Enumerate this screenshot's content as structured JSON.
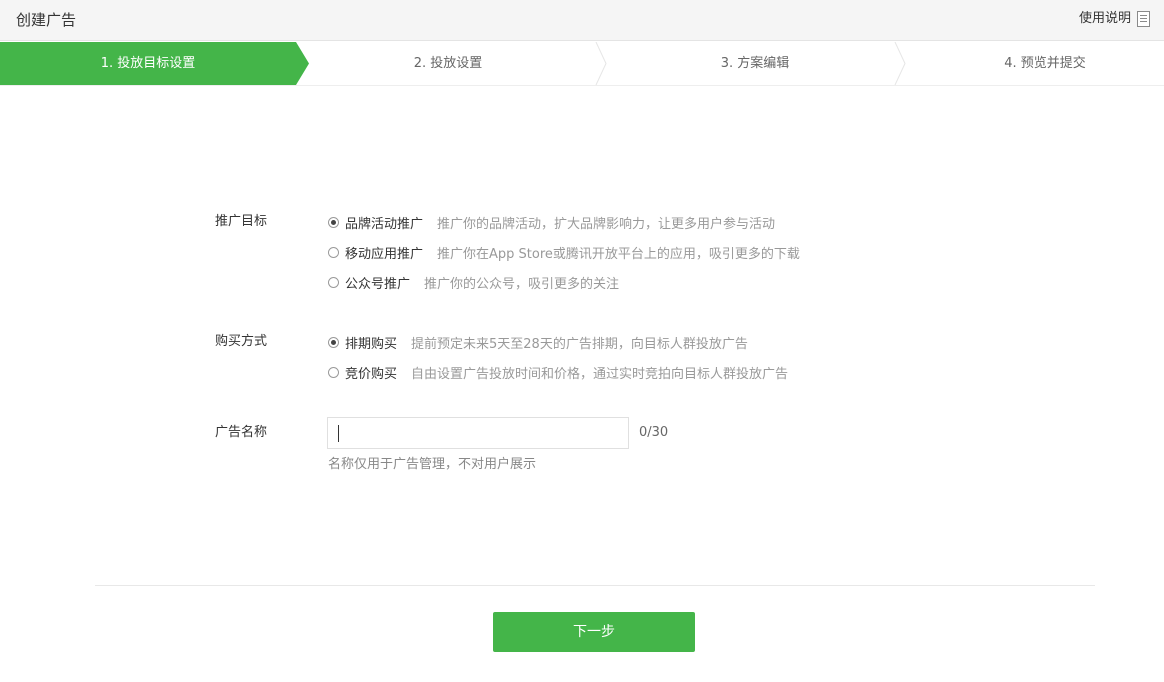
{
  "header": {
    "title": "创建广告",
    "help_label": "使用说明",
    "help_icon": "document-icon"
  },
  "steps": [
    {
      "label": "1. 投放目标设置",
      "active": true
    },
    {
      "label": "2. 投放设置",
      "active": false
    },
    {
      "label": "3. 方案编辑",
      "active": false
    },
    {
      "label": "4. 预览并提交",
      "active": false
    }
  ],
  "colors": {
    "accent": "#44b549",
    "muted_text": "#999999"
  },
  "form": {
    "goal": {
      "label": "推广目标",
      "options": [
        {
          "label": "品牌活动推广",
          "desc": "推广你的品牌活动，扩大品牌影响力，让更多用户参与活动",
          "checked": true
        },
        {
          "label": "移动应用推广",
          "desc": "推广你在App Store或腾讯开放平台上的应用，吸引更多的下载",
          "checked": false
        },
        {
          "label": "公众号推广",
          "desc": "推广你的公众号，吸引更多的关注",
          "checked": false
        }
      ]
    },
    "purchase": {
      "label": "购买方式",
      "options": [
        {
          "label": "排期购买",
          "desc": "提前预定未来5天至28天的广告排期，向目标人群投放广告",
          "checked": true
        },
        {
          "label": "竞价购买",
          "desc": "自由设置广告投放时间和价格，通过实时竞拍向目标人群投放广告",
          "checked": false
        }
      ]
    },
    "ad_name": {
      "label": "广告名称",
      "value": "",
      "count": "0/30",
      "hint": "名称仅用于广告管理，不对用户展示"
    }
  },
  "footer": {
    "next_label": "下一步"
  }
}
